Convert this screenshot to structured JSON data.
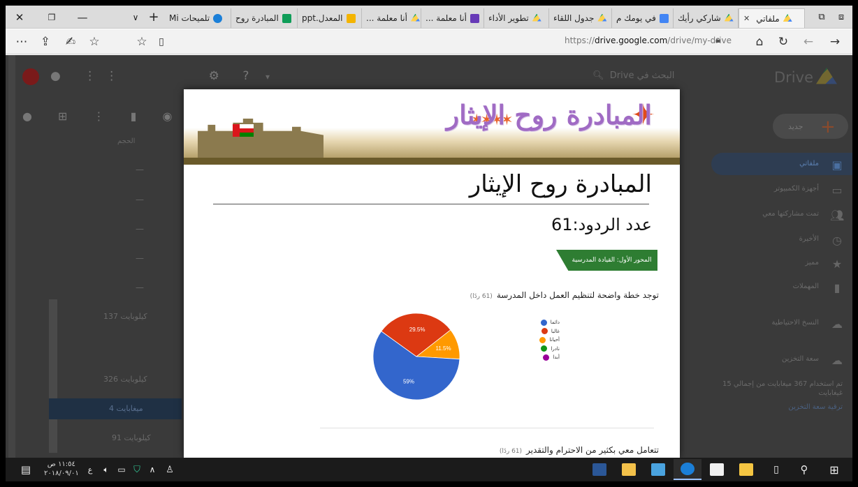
{
  "browser": {
    "tabs": [
      {
        "label": "ملفاتي",
        "icon": "drive",
        "active": true
      },
      {
        "label": "شاركي رأيك",
        "icon": "drive"
      },
      {
        "label": "في يومك م",
        "icon": "docs"
      },
      {
        "label": "جدول اللقاء",
        "icon": "drive"
      },
      {
        "label": "تطوير الأداء",
        "icon": "forms"
      },
      {
        "label": "أنا معلمة ...",
        "icon": "drive"
      },
      {
        "label": "أنا معلمة ...",
        "icon": "drive"
      },
      {
        "label": "المعدل.ppt",
        "icon": "slides"
      },
      {
        "label": "المبادرة روح",
        "icon": "sheets"
      },
      {
        "label": "تلميحات Mi",
        "icon": "ie"
      }
    ],
    "url_prefix": "https://",
    "url_host": "drive.google.com",
    "url_path": "/drive/my-drive"
  },
  "drive": {
    "logo": "Drive",
    "search_placeholder": "البحث في Drive",
    "new_label": "جديد",
    "sidebar": [
      {
        "label": "ملفاتي",
        "icon": "drive-folder-icon"
      },
      {
        "label": "أجهزة الكمبيوتر",
        "icon": "computer-icon"
      },
      {
        "label": "تمت مشاركتها معي",
        "icon": "people-icon"
      },
      {
        "label": "الأخيرة",
        "icon": "clock-icon"
      },
      {
        "label": "مميز",
        "icon": "star-icon"
      },
      {
        "label": "المهملات",
        "icon": "trash-icon"
      },
      {
        "label": "النسخ الاحتياطية",
        "icon": "cloud-icon"
      },
      {
        "label": "سعة التخزين",
        "icon": "cloud-outline-icon"
      }
    ],
    "storage_text": "تم استخدام 367 ميغابايت من إجمالي 15 غيغابايت",
    "storage_upgrade": "ترقية سعة التخزين",
    "column_size": "الحجم",
    "sizes": [
      "—",
      "—",
      "—",
      "—",
      "—",
      "137 كيلوبايت",
      "326 كيلوبايت",
      "4 ميغابايت",
      "91 كيلوبايت"
    ]
  },
  "modal": {
    "banner_text": "المبادرة روح الإيثار",
    "form_title": "المبادرة روح الإيثار",
    "response_count": "عدد الردود:61",
    "section_label": "المحور الأول: القيادة المدرسية",
    "questions": [
      {
        "title": "توجد خطة واضحة لتنظيم العمل داخل المدرسة",
        "count": "(61 ردًا)"
      },
      {
        "title": "تتعامل معي بكثير من الاحترام والتقدير",
        "count": "(61 ردًا)"
      }
    ]
  },
  "chart_data": {
    "type": "pie",
    "title": "توجد خطة واضحة لتنظيم العمل داخل المدرسة",
    "categories": [
      "دائما",
      "غالبا",
      "أحيانا",
      "نادرا",
      "أبدا"
    ],
    "values": [
      59,
      29.5,
      11.5,
      0,
      0
    ],
    "data_labels": [
      "59%",
      "29.5%",
      "11.5%",
      "",
      ""
    ],
    "colors": [
      "#3366cc",
      "#dc3912",
      "#ff9900",
      "#109618",
      "#990099"
    ],
    "legend": "right"
  },
  "taskbar": {
    "time": "١١:٥٤ ص",
    "date": "٢٠١٨/٠٩/٠١",
    "lang": "ع"
  }
}
